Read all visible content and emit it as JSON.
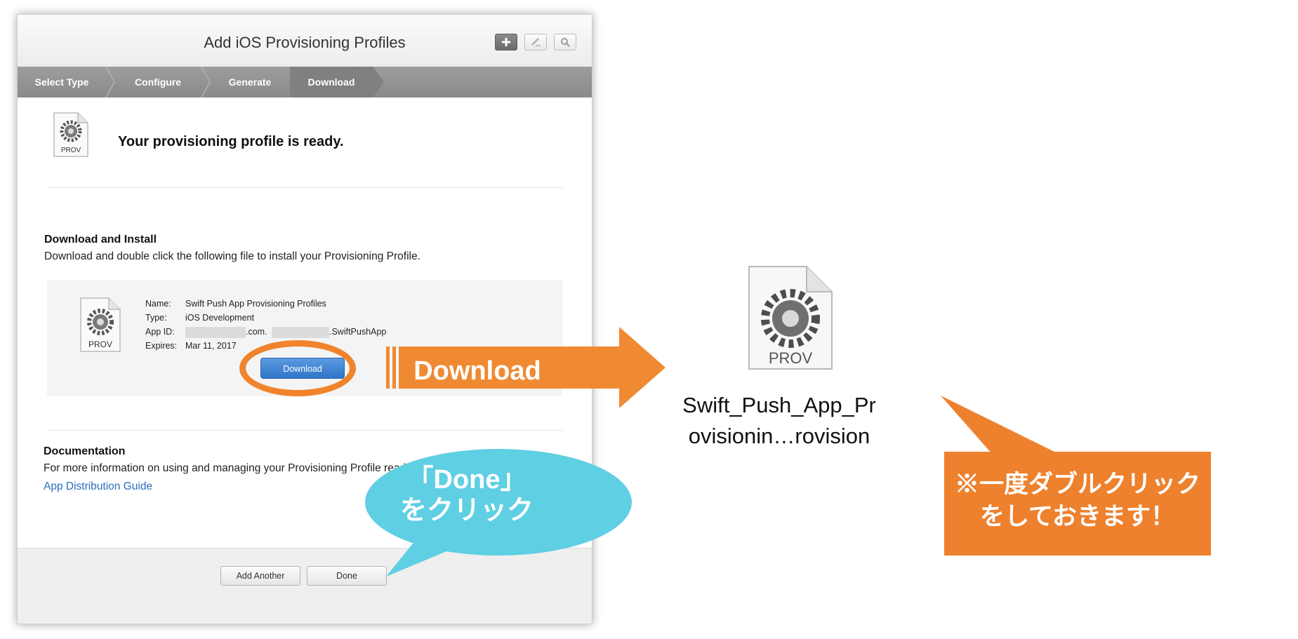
{
  "window": {
    "title": "Add iOS Provisioning Profiles",
    "toolbar": {
      "add_icon": "plus-icon",
      "edit_icon": "pencil-icon",
      "search_icon": "search-icon"
    },
    "steps": [
      "Select Type",
      "Configure",
      "Generate",
      "Download"
    ],
    "active_step": "Download"
  },
  "ready": {
    "heading": "Your provisioning profile is ready.",
    "icon_label": "PROV"
  },
  "download_section": {
    "title": "Download and Install",
    "description": "Download and double click the following file to install your Provisioning Profile."
  },
  "profile": {
    "icon_label": "PROV",
    "name_label": "Name:",
    "name": "Swift Push App Provisioning Profiles",
    "type_label": "Type:",
    "type": "iOS Development",
    "appid_label": "App ID:",
    "appid_mid": ".com.",
    "appid_end": ".SwiftPushApp",
    "expires_label": "Expires:",
    "expires": "Mar 11, 2017",
    "download_button": "Download"
  },
  "documentation": {
    "title": "Documentation",
    "description": "For more information on using and managing your Provisioning Profile read:",
    "link": "App Distribution Guide"
  },
  "footer": {
    "add_another": "Add Another",
    "done": "Done"
  },
  "annotations": {
    "arrow_label": "Download",
    "bubble_line1": "「Done」",
    "bubble_line2": "をクリック",
    "file_icon_label": "PROV",
    "file_name_line1": "Swift_Push_App_Pr",
    "file_name_line2": "ovisionin…rovision",
    "callout_line1": "※一度ダブルクリック",
    "callout_line2": "をしておきます！"
  },
  "colors": {
    "accent_orange": "#ee812e",
    "bubble_cyan": "#5fcfe3",
    "link_blue": "#2a6dbb",
    "button_blue": "#2f74c8"
  }
}
